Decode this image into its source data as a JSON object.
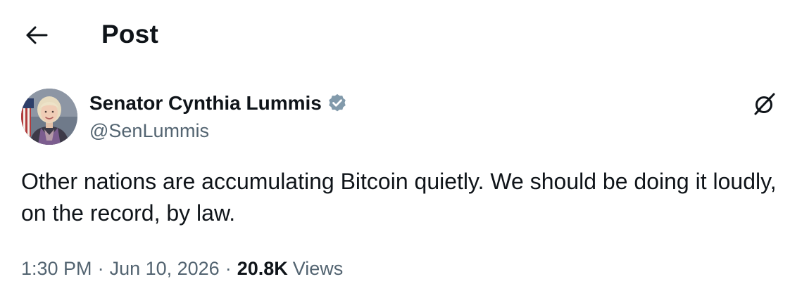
{
  "header": {
    "title": "Post",
    "back_icon": "arrow-left-icon"
  },
  "author": {
    "name": "Senator Cynthia Lummis",
    "handle": "@SenLummis",
    "verified_icon": "verified-badge-icon",
    "verified_color": "#829aab",
    "avatar_icon": "avatar-photo"
  },
  "grok_icon": "grok-icon",
  "post": {
    "text": "Other nations are accumulating Bitcoin quietly. We should be doing it loudly, on the record, by law."
  },
  "meta": {
    "time": "1:30 PM",
    "separator": "·",
    "date": "Jun 10, 2026",
    "views_count": "20.8K",
    "views_label": "Views"
  },
  "colors": {
    "text_primary": "#0f1419",
    "text_secondary": "#536471",
    "background": "#ffffff"
  }
}
